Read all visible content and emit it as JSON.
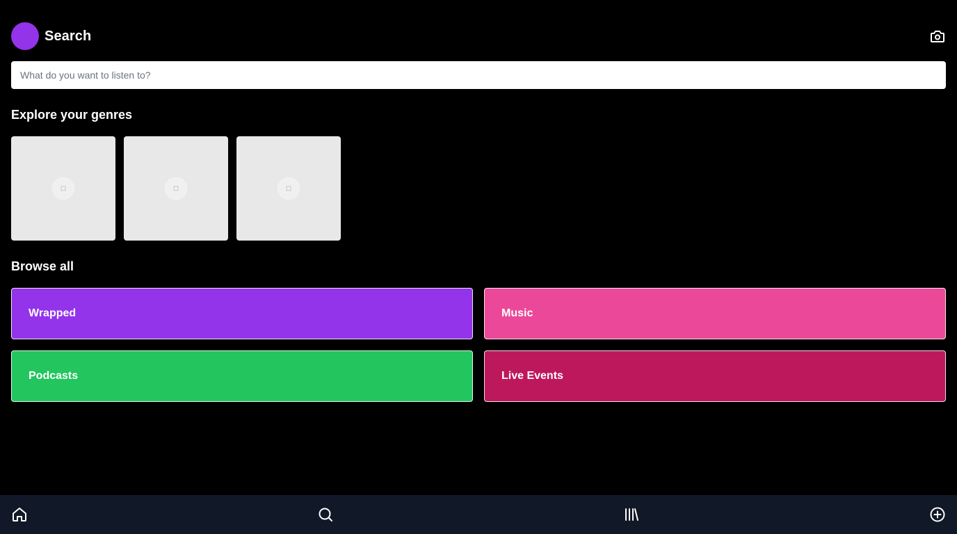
{
  "header": {
    "title": "Search",
    "avatar_color": "#9333ea",
    "camera_icon": "camera-icon"
  },
  "search": {
    "placeholder": "What do you want to listen to?",
    "value": ""
  },
  "genres": {
    "title": "Explore your genres",
    "items": [
      {
        "icon": "image-placeholder-icon"
      },
      {
        "icon": "image-placeholder-icon"
      },
      {
        "icon": "image-placeholder-icon"
      }
    ]
  },
  "browse": {
    "title": "Browse all",
    "categories": [
      {
        "label": "Wrapped",
        "color": "#9333ea"
      },
      {
        "label": "Music",
        "color": "#ec4899"
      },
      {
        "label": "Podcasts",
        "color": "#22c55e"
      },
      {
        "label": "Live Events",
        "color": "#be185d"
      }
    ]
  },
  "bottom_nav": {
    "background": "#111827",
    "items": [
      {
        "icon": "home-icon"
      },
      {
        "icon": "search-icon"
      },
      {
        "icon": "library-icon"
      },
      {
        "icon": "add-circle-icon"
      }
    ]
  }
}
